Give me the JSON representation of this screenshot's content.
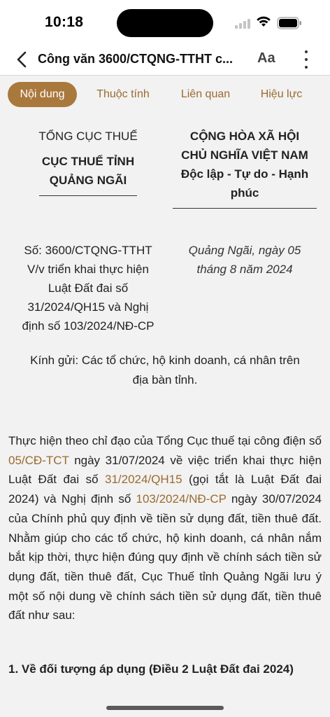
{
  "status": {
    "time": "10:18"
  },
  "nav": {
    "title": "Công văn 3600/CTQNG-TTHT c...",
    "font_label": "Aa"
  },
  "tabs": [
    {
      "label": "Nội dung",
      "active": true
    },
    {
      "label": "Thuộc tính",
      "active": false
    },
    {
      "label": "Liên quan",
      "active": false
    },
    {
      "label": "Hiệu lực",
      "active": false
    }
  ],
  "document": {
    "issuer_parent": "TỔNG CỤC THUẾ",
    "issuer_line1": "CỤC THUẾ TỈNH",
    "issuer_line2": "QUẢNG NGÃI",
    "nation_line1": "CỘNG HÒA XÃ HỘI",
    "nation_line2": "CHỦ NGHĨA VIỆT NAM",
    "motto_line1": "Độc lập - Tự do - Hạnh",
    "motto_line2": "phúc",
    "ref_line1": "Số: 3600/CTQNG-TTHT",
    "ref_line2": "V/v triển khai thực hiện",
    "ref_line3": "Luật Đất đai số",
    "ref_line4": "31/2024/QH15 và Nghị",
    "ref_line5": "định số 103/2024/NĐ-CP",
    "date_line1": "Quảng Ngãi, ngày 05",
    "date_line2": "tháng 8 năm 2024",
    "recipient_line1": "Kính gửi: Các tổ chức, hộ kinh doanh, cá nhân trên",
    "recipient_line2": "địa bàn tỉnh.",
    "body_part1": "Thực hiện theo chỉ đạo của Tổng Cục thuế tại công điện số ",
    "body_link1": "05/CĐ-TCT",
    "body_part2": " ngày 31/07/2024 về việc triển khai thực hiện Luật Đất đai số ",
    "body_link2": "31/2024/QH15",
    "body_part3": " (gọi tắt là Luật Đất đai 2024) và Nghị định số ",
    "body_link3": "103/2024/NĐ-CP",
    "body_part4": " ngày 30/07/2024 của Chính phủ quy định về tiền sử dụng đất, tiền thuê đất. Nhằm giúp cho các tổ chức, hộ kinh doanh, cá nhân nắm bắt kịp thời, thực hiện đúng quy định về chính sách tiền sử dụng đất, tiền thuê đất, Cục Thuế tỉnh Quảng Ngãi lưu ý một số nội dung về chính sách tiền sử dụng đất, tiền thuê đất như sau:",
    "section1_heading": "1. Về đối tượng áp dụng (Điều 2 Luật Đất đai 2024)"
  },
  "colors": {
    "accent": "#a9783d",
    "link": "#9a6b2f"
  }
}
